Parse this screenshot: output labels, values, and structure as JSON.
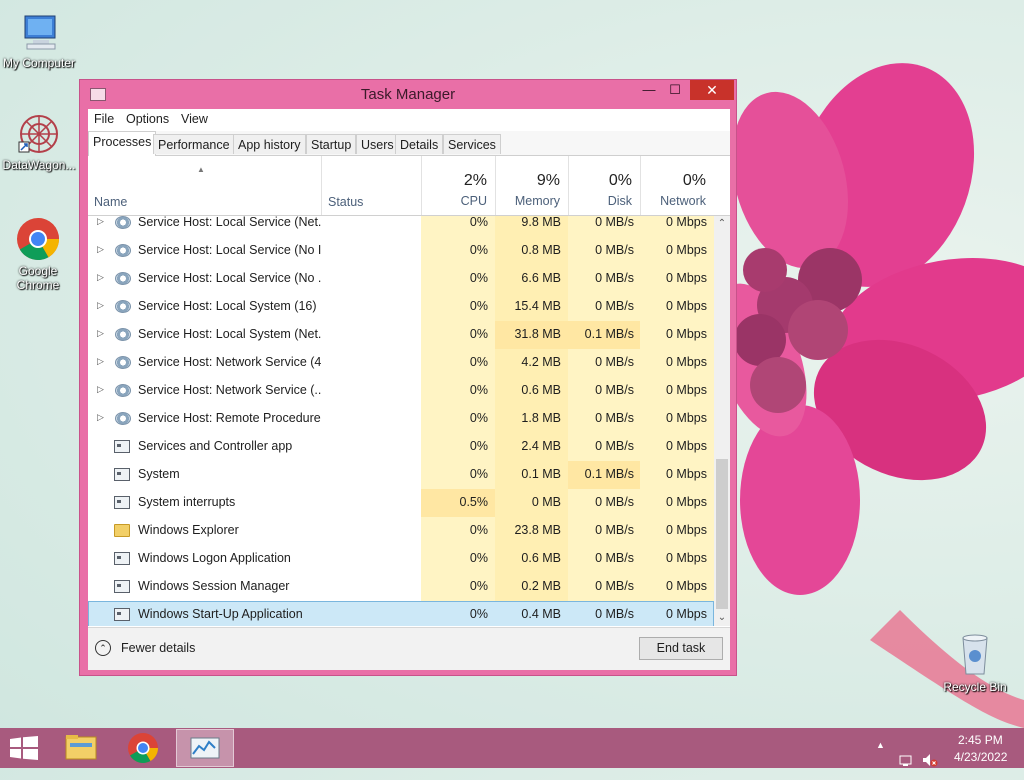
{
  "desktop": {
    "icons": [
      {
        "label": "My Computer"
      },
      {
        "label": "DataWagon..."
      },
      {
        "label": "Google Chrome"
      },
      {
        "label": "Recycle Bin"
      }
    ]
  },
  "window": {
    "title": "Task Manager",
    "controls": {
      "minimize": "—",
      "maximize": "☐",
      "close": "✕"
    },
    "menu": [
      "File",
      "Options",
      "View"
    ],
    "tabs": [
      "Processes",
      "Performance",
      "App history",
      "Startup",
      "Users",
      "Details",
      "Services"
    ],
    "active_tab": "Processes",
    "columns": {
      "name": "Name",
      "status": "Status",
      "cpu": {
        "pct": "2%",
        "label": "CPU"
      },
      "memory": {
        "pct": "9%",
        "label": "Memory"
      },
      "disk": {
        "pct": "0%",
        "label": "Disk"
      },
      "network": {
        "pct": "0%",
        "label": "Network"
      }
    },
    "rows": [
      {
        "name": "Service Host: Local Service (Net...",
        "cpu": "0%",
        "memory": "9.8 MB",
        "disk": "0 MB/s",
        "network": "0 Mbps",
        "icon": "gear-icon",
        "expandable": true
      },
      {
        "name": "Service Host: Local Service (No I...",
        "cpu": "0%",
        "memory": "0.8 MB",
        "disk": "0 MB/s",
        "network": "0 Mbps",
        "icon": "gear-icon",
        "expandable": true
      },
      {
        "name": "Service Host: Local Service (No ...",
        "cpu": "0%",
        "memory": "6.6 MB",
        "disk": "0 MB/s",
        "network": "0 Mbps",
        "icon": "gear-icon",
        "expandable": true
      },
      {
        "name": "Service Host: Local System (16)",
        "cpu": "0%",
        "memory": "15.4 MB",
        "disk": "0 MB/s",
        "network": "0 Mbps",
        "icon": "gear-icon",
        "expandable": true
      },
      {
        "name": "Service Host: Local System (Net...",
        "cpu": "0%",
        "memory": "31.8 MB",
        "disk": "0.1 MB/s",
        "network": "0 Mbps",
        "icon": "gear-icon",
        "expandable": true
      },
      {
        "name": "Service Host: Network Service (4)",
        "cpu": "0%",
        "memory": "4.2 MB",
        "disk": "0 MB/s",
        "network": "0 Mbps",
        "icon": "gear-icon",
        "expandable": true
      },
      {
        "name": "Service Host: Network Service (...",
        "cpu": "0%",
        "memory": "0.6 MB",
        "disk": "0 MB/s",
        "network": "0 Mbps",
        "icon": "gear-icon",
        "expandable": true
      },
      {
        "name": "Service Host: Remote Procedure...",
        "cpu": "0%",
        "memory": "1.8 MB",
        "disk": "0 MB/s",
        "network": "0 Mbps",
        "icon": "gear-icon",
        "expandable": true
      },
      {
        "name": "Services and Controller app",
        "cpu": "0%",
        "memory": "2.4 MB",
        "disk": "0 MB/s",
        "network": "0 Mbps",
        "icon": "app-icon",
        "expandable": false
      },
      {
        "name": "System",
        "cpu": "0%",
        "memory": "0.1 MB",
        "disk": "0.1 MB/s",
        "network": "0 Mbps",
        "icon": "app-icon",
        "expandable": false
      },
      {
        "name": "System interrupts",
        "cpu": "0.5%",
        "memory": "0 MB",
        "disk": "0 MB/s",
        "network": "0 Mbps",
        "icon": "app-icon",
        "expandable": false
      },
      {
        "name": "Windows Explorer",
        "cpu": "0%",
        "memory": "23.8 MB",
        "disk": "0 MB/s",
        "network": "0 Mbps",
        "icon": "folder-icon",
        "expandable": false
      },
      {
        "name": "Windows Logon Application",
        "cpu": "0%",
        "memory": "0.6 MB",
        "disk": "0 MB/s",
        "network": "0 Mbps",
        "icon": "app-icon",
        "expandable": false
      },
      {
        "name": "Windows Session Manager",
        "cpu": "0%",
        "memory": "0.2 MB",
        "disk": "0 MB/s",
        "network": "0 Mbps",
        "icon": "app-icon",
        "expandable": false
      },
      {
        "name": "Windows Start-Up Application",
        "cpu": "0%",
        "memory": "0.4 MB",
        "disk": "0 MB/s",
        "network": "0 Mbps",
        "icon": "app-icon",
        "expandable": false
      }
    ],
    "selected_row": "Windows Start-Up Application",
    "footer": {
      "fewer_details": "Fewer details",
      "end_task": "End task"
    }
  },
  "taskbar": {
    "pinned": [
      "start-button",
      "file-explorer-icon",
      "chrome-icon",
      "task-manager-icon"
    ],
    "clock": {
      "time": "2:45 PM",
      "date": "4/23/2022"
    }
  },
  "colors": {
    "window_frame": "#e96fa7",
    "taskbar": "#a85a7e",
    "close_button": "#c8322a",
    "selection": "#cce8f7",
    "heat_light": "#fff4c4",
    "heat_medium": "#ffe7a3"
  }
}
